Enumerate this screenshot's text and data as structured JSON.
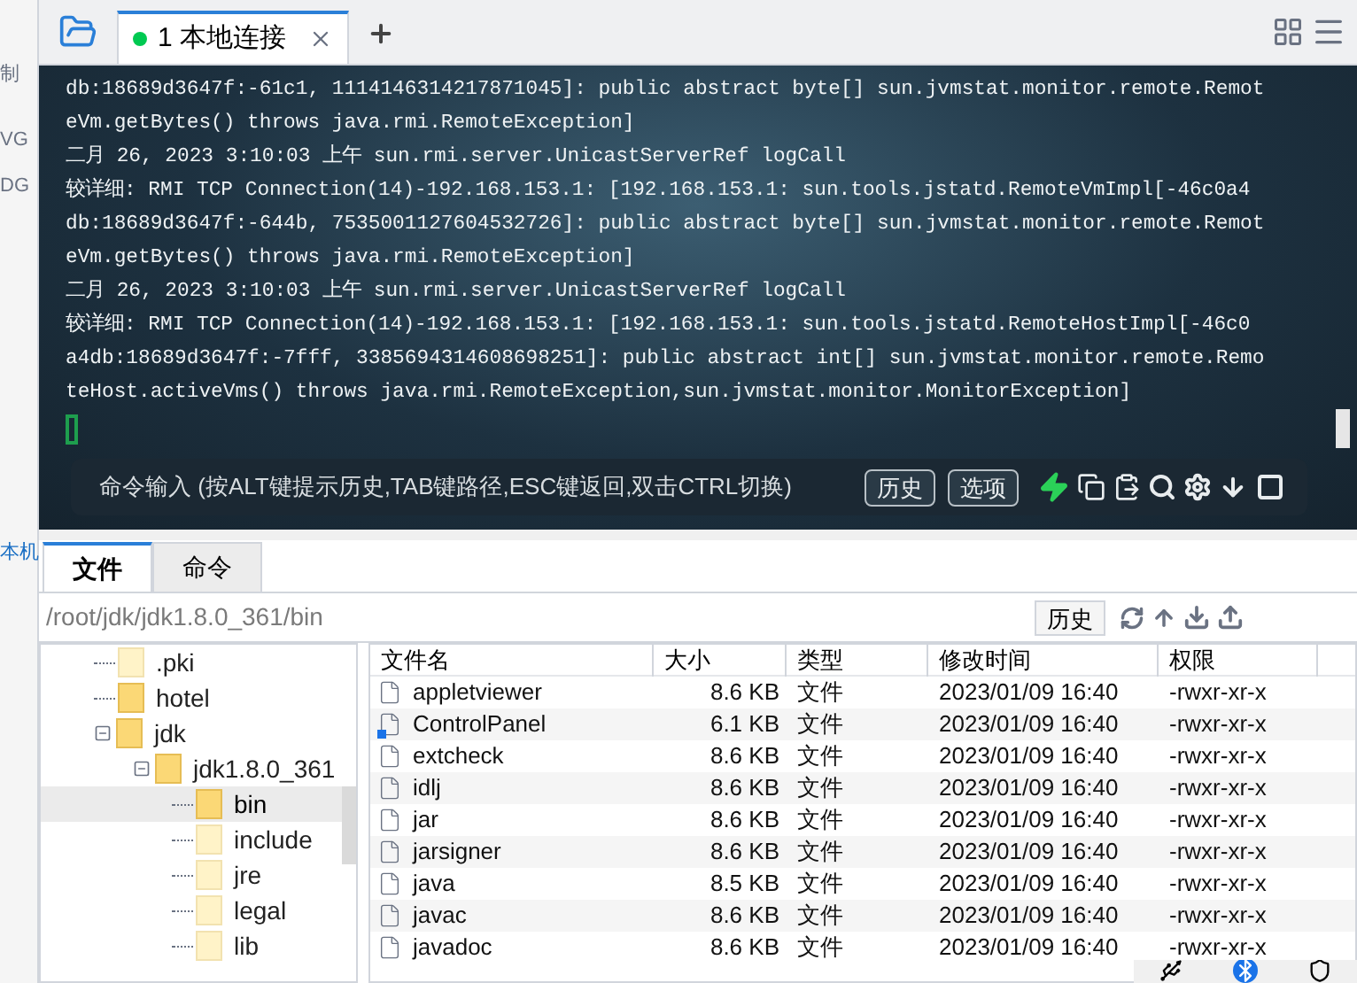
{
  "left_strip": {
    "texts": [
      "制",
      "VG",
      "DG",
      "本机"
    ]
  },
  "tabs": [
    {
      "label": "1 本地连接",
      "connected": true,
      "selected": true
    }
  ],
  "terminal": {
    "lines": [
      "db:18689d3647f:-61c1, 1114146314217871045]: public abstract byte[] sun.jvmstat.monitor.remote.Remot",
      "eVm.getBytes() throws java.rmi.RemoteException]",
      "二月 26, 2023 3:10:03 上午 sun.rmi.server.UnicastServerRef logCall",
      "较详细: RMI TCP Connection(14)-192.168.153.1: [192.168.153.1: sun.tools.jstatd.RemoteVmImpl[-46c0a4",
      "db:18689d3647f:-644b, 7535001127604532726]: public abstract byte[] sun.jvmstat.monitor.remote.Remot",
      "eVm.getBytes() throws java.rmi.RemoteException]",
      "二月 26, 2023 3:10:03 上午 sun.rmi.server.UnicastServerRef logCall",
      "较详细: RMI TCP Connection(14)-192.168.153.1: [192.168.153.1: sun.tools.jstatd.RemoteHostImpl[-46c0",
      "a4db:18689d3647f:-7fff, 3385694314608698251]: public abstract int[] sun.jvmstat.monitor.remote.Remo",
      "teHost.activeVms() throws java.rmi.RemoteException,sun.jvmstat.monitor.MonitorException]"
    ],
    "command_input": {
      "placeholder": "命令输入 (按ALT键提示历史,TAB键路径,ESC键返回,双击CTRL切换)"
    },
    "buttons": [
      "历史",
      "选项"
    ]
  },
  "bottom_tabs": [
    {
      "label": "文件",
      "selected": true
    },
    {
      "label": "命令",
      "selected": false
    }
  ],
  "path_bar": {
    "path": "/root/jdk/jdk1.8.0_361/bin",
    "history_button": "历史"
  },
  "tree": [
    {
      "name": ".pki",
      "dim": true
    },
    {
      "name": "hotel",
      "dim": false
    },
    {
      "name": "jdk",
      "dim": false,
      "expanded": true,
      "children": [
        {
          "name": "jdk1.8.0_361",
          "dim": false,
          "expanded": true,
          "children": [
            {
              "name": "bin",
              "dim": false,
              "selected": true
            },
            {
              "name": "include",
              "dim": true
            },
            {
              "name": "jre",
              "dim": true
            },
            {
              "name": "legal",
              "dim": true
            },
            {
              "name": "lib",
              "dim": true
            }
          ]
        }
      ]
    }
  ],
  "table": {
    "columns": [
      "文件名",
      "大小",
      "类型",
      "修改时间",
      "权限"
    ],
    "rows": [
      {
        "name": "appletviewer",
        "size": "8.6 KB",
        "type": "文件",
        "modified": "2023/01/09 16:40",
        "perm": "-rwxr-xr-x",
        "link": false
      },
      {
        "name": "ControlPanel",
        "size": "6.1 KB",
        "type": "文件",
        "modified": "2023/01/09 16:40",
        "perm": "-rwxr-xr-x",
        "link": true
      },
      {
        "name": "extcheck",
        "size": "8.6 KB",
        "type": "文件",
        "modified": "2023/01/09 16:40",
        "perm": "-rwxr-xr-x",
        "link": false
      },
      {
        "name": "idlj",
        "size": "8.6 KB",
        "type": "文件",
        "modified": "2023/01/09 16:40",
        "perm": "-rwxr-xr-x",
        "link": false
      },
      {
        "name": "jar",
        "size": "8.6 KB",
        "type": "文件",
        "modified": "2023/01/09 16:40",
        "perm": "-rwxr-xr-x",
        "link": false
      },
      {
        "name": "jarsigner",
        "size": "8.6 KB",
        "type": "文件",
        "modified": "2023/01/09 16:40",
        "perm": "-rwxr-xr-x",
        "link": false
      },
      {
        "name": "java",
        "size": "8.5 KB",
        "type": "文件",
        "modified": "2023/01/09 16:40",
        "perm": "-rwxr-xr-x",
        "link": false
      },
      {
        "name": "javac",
        "size": "8.6 KB",
        "type": "文件",
        "modified": "2023/01/09 16:40",
        "perm": "-rwxr-xr-x",
        "link": false
      },
      {
        "name": "javadoc",
        "size": "8.6 KB",
        "type": "文件",
        "modified": "2023/01/09 16:40",
        "perm": "-rwxr-xr-x",
        "link": false
      }
    ]
  }
}
